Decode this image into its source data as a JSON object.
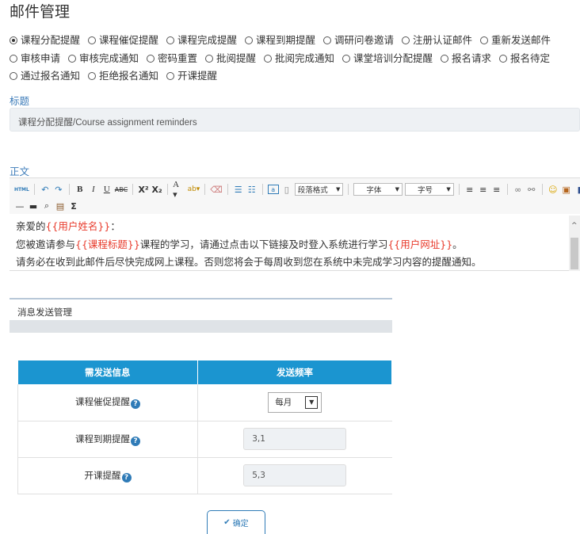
{
  "page": {
    "title": "邮件管理"
  },
  "templates": {
    "selected": "课程分配提醒",
    "options": [
      "课程分配提醒",
      "课程催促提醒",
      "课程完成提醒",
      "课程到期提醒",
      "调研问卷邀请",
      "注册认证邮件",
      "重新发送邮件",
      "审核申请",
      "审核完成通知",
      "密码重置",
      "批阅提醒",
      "批阅完成通知",
      "课堂培训分配提醒",
      "报名请求",
      "报名待定",
      "通过报名通知",
      "拒绝报名通知",
      "开课提醒"
    ]
  },
  "subject": {
    "label": "标题",
    "value": "课程分配提醒/Course assignment reminders"
  },
  "body": {
    "label": "正文",
    "toolbar": {
      "paragraph_format": "段落格式",
      "font_family": "字体",
      "font_size": "字号"
    },
    "line1": {
      "prefix": "亲爱的",
      "token": "{{用户姓名}}",
      "suffix": "："
    },
    "line2": {
      "prefix": "您被邀请参与",
      "token1": "{{课程标题}}",
      "middle": "课程的学习，请通过点击以下链接及时登入系统进行学习",
      "token2": "{{用户网址}}",
      "suffix": "。"
    },
    "line3": "请务必在收到此邮件后尽快完成网上课程。否则您将会于每周收到您在系统中未完成学习内容的提醒通知。"
  },
  "panel": {
    "title": "消息发送管理"
  },
  "settings": {
    "headers": [
      "需发送信息",
      "发送频率"
    ],
    "rows": [
      {
        "label": "课程催促提醒",
        "type": "select",
        "value": "每月"
      },
      {
        "label": "课程到期提醒",
        "type": "input",
        "value": "3,1"
      },
      {
        "label": "开课提醒",
        "type": "input",
        "value": "5,3"
      }
    ]
  },
  "confirm": {
    "label": "确定"
  },
  "colors": {
    "accent": "#1b95d0",
    "link": "#2f7bb7",
    "token": "#e83b2c"
  }
}
